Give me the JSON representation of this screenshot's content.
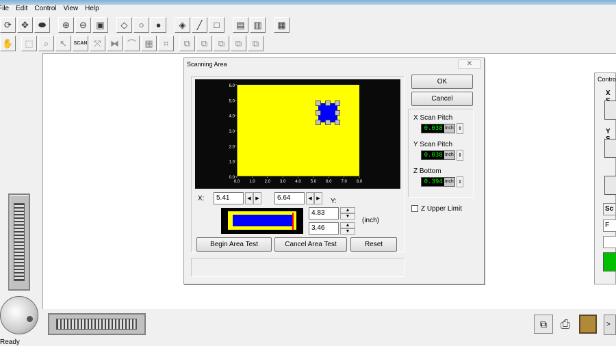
{
  "menu": [
    "File",
    "Edit",
    "Control",
    "View",
    "Help"
  ],
  "toolbar_row1": [
    "rotate-icon",
    "move-icon",
    "cylinder-icon",
    "zoom-in-icon",
    "zoom-out-icon",
    "fit-icon",
    "box-icon",
    "sphere-outline-icon",
    "sphere-icon",
    "paint-bucket-icon",
    "brush-icon",
    "blank-icon",
    "cube-stack-icon",
    "grid-map-icon",
    "palette-icon"
  ],
  "toolbar_row2": [
    "hand-icon",
    "select-rect-icon",
    "magnifier-icon",
    "lasso-icon",
    "scan-icon",
    "expand-icon",
    "mirror-icon",
    "arch-icon",
    "crop-icon",
    "frame-icon",
    "cube1-icon",
    "cube2-icon",
    "cube3-icon",
    "cube4-icon",
    "cube5-icon"
  ],
  "scan_label": "SCAN",
  "status": "Ready",
  "dialog": {
    "title": "Scanning Area",
    "close": "✕",
    "ok": "OK",
    "cancel": "Cancel",
    "x_scan_pitch_label": "X Scan Pitch",
    "x_scan_pitch_value": "0.038",
    "y_scan_pitch_label": "Y Scan Pitch",
    "y_scan_pitch_value": "0.038",
    "z_bottom_label": "Z Bottom",
    "z_bottom_value": "0.394",
    "unit": "inch",
    "z_upper_limit_label": "Z Upper Limit",
    "x_label": "X:",
    "x_value1": "5.41",
    "x_value2": "6.64",
    "y_label": "Y:",
    "y_value1": "4.83",
    "y_value2": "3.46",
    "unit_paren": "(inch)",
    "begin_test": "Begin Area Test",
    "cancel_test": "Cancel Area Test",
    "reset": "Reset",
    "plot": {
      "y_ticks": [
        "6.0",
        "5.0",
        "4.0",
        "3.0",
        "2.0",
        "1.0",
        "0.0"
      ],
      "x_ticks": [
        "0.0",
        "1.0",
        "2.0",
        "3.0",
        "4.0",
        "5.0",
        "6.0",
        "7.0",
        "8.0"
      ],
      "bg_color": "#ffff00",
      "selection_color": "#0000ff"
    }
  },
  "control_panel": {
    "title": "Contro",
    "labels": [
      "X S",
      "Y S",
      "Sc",
      "F"
    ]
  }
}
